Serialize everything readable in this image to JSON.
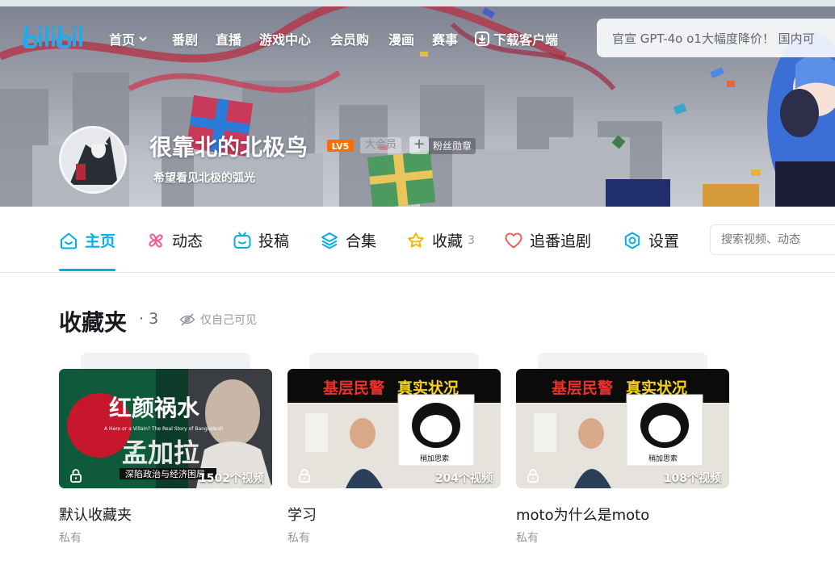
{
  "nav": {
    "home": "首页",
    "items": [
      "番剧",
      "直播",
      "游戏中心",
      "会员购",
      "漫画",
      "赛事"
    ],
    "download": "下载客户端",
    "search_placeholder": "官宣 GPT-4o o1大幅度降价！ 国内可"
  },
  "profile": {
    "name": "很靠北的北极鸟",
    "level": "LV5",
    "vip": "大会员",
    "fan_badge": "粉丝勋章",
    "signature": "希望看见北极的弧光"
  },
  "tabs": {
    "home": "主页",
    "dynamic": "动态",
    "upload": "投稿",
    "collection": "合集",
    "favorites": "收藏",
    "favorites_count": "3",
    "bangumi": "追番追剧",
    "settings": "设置"
  },
  "space_search": {
    "placeholder": "搜索视频、动态"
  },
  "favorites": {
    "title": "收藏夹",
    "dot": "·",
    "count": "3",
    "visibility": "仅自己可见",
    "folders": [
      {
        "title": "默认收藏夹",
        "status": "私有",
        "count_label": "1502个视频",
        "cover_title_1": "红颜祸水",
        "cover_title_2": "孟加拉",
        "cover_sub": "A Hero or a Villain? The Real Story of Bangladesh",
        "cover_bottom": "深陷政治与经济困局"
      },
      {
        "title": "学习",
        "status": "私有",
        "count_label": "204个视频",
        "cover_left": "基层民警",
        "cover_right": "真实状况",
        "cover_caption": "稍加思索"
      },
      {
        "title": "moto为什么是moto",
        "status": "私有",
        "count_label": "108个视频",
        "cover_left": "基层民警",
        "cover_right": "真实状况",
        "cover_caption": "稍加思索"
      }
    ]
  },
  "colors": {
    "accent": "#00aeec",
    "vip_pink": "#fb7299",
    "level_orange": "#ff6c00"
  }
}
